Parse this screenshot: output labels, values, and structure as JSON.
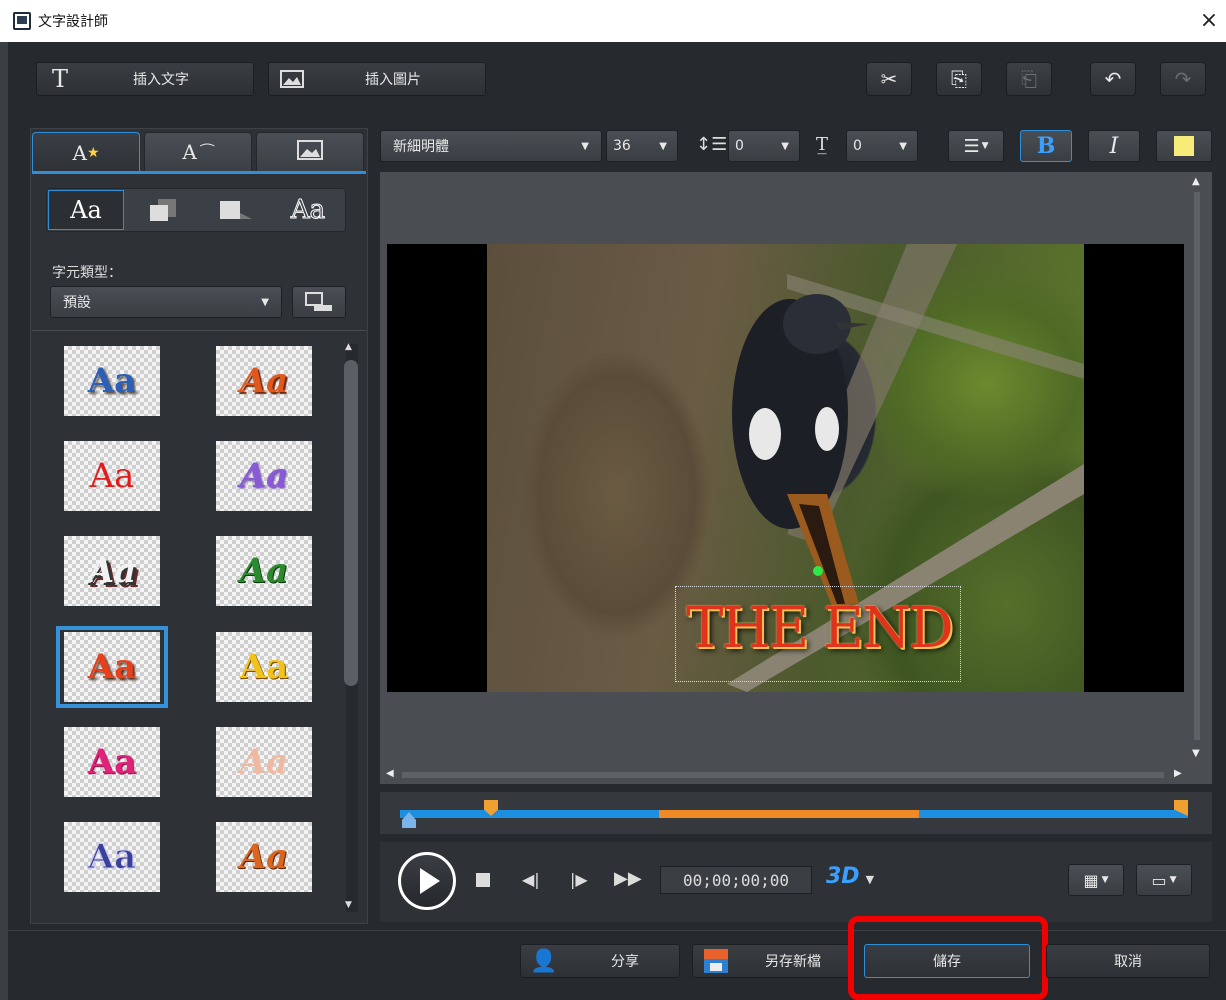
{
  "window": {
    "title": "文字設計師",
    "close_glyph": "×"
  },
  "toolbar": {
    "insert_text_label": "插入文字",
    "insert_image_label": "插入圖片",
    "cut_icon": "scissors-icon",
    "copy_icon": "copy-icon",
    "paste_icon": "paste-icon",
    "undo_icon": "undo-icon",
    "redo_icon": "redo-icon"
  },
  "left_panel": {
    "tabs": [
      "A",
      "A",
      ""
    ],
    "style_subtabs": [
      "Aa",
      "",
      "",
      "Aa"
    ],
    "char_type_label": "字元類型：",
    "char_type_value": "預設",
    "styles": [
      {
        "label": "Aa",
        "color": "#2c5fb8"
      },
      {
        "label": "Aa",
        "color": "#e2571e"
      },
      {
        "label": "Aa",
        "color": "#e21b1b"
      },
      {
        "label": "Aa",
        "color": "#8a5ad6"
      },
      {
        "label": "Aa",
        "color": "#f2f2f2"
      },
      {
        "label": "Aa",
        "color": "#2c8a2e"
      },
      {
        "label": "Aa",
        "color": "#e8401b"
      },
      {
        "label": "Aa",
        "color": "#f1c21b"
      },
      {
        "label": "Aa",
        "color": "#e4217a"
      },
      {
        "label": "Aa",
        "color": "#f0b8a0"
      },
      {
        "label": "Aa",
        "color": "#3a3f9a"
      },
      {
        "label": "Aa",
        "color": "#d9651f"
      }
    ],
    "selected_style_index": 6
  },
  "format_bar": {
    "font": "新細明體",
    "size": "36",
    "line_spacing": "0",
    "char_spacing": "0",
    "bold": "B",
    "italic": "I",
    "color_swatch": "#f7ec7a"
  },
  "preview": {
    "title_text": "THE END",
    "title_color": "#e0331b"
  },
  "playback": {
    "timecode": "00;00;00;00",
    "mode_3d": "3D"
  },
  "footer": {
    "share_label": "分享",
    "save_as_label": "另存新檔",
    "save_label": "儲存",
    "cancel_label": "取消"
  },
  "colors": {
    "accent": "#1d8fe0",
    "highlight": "#f00000",
    "timeline_orange": "#f08a24"
  }
}
